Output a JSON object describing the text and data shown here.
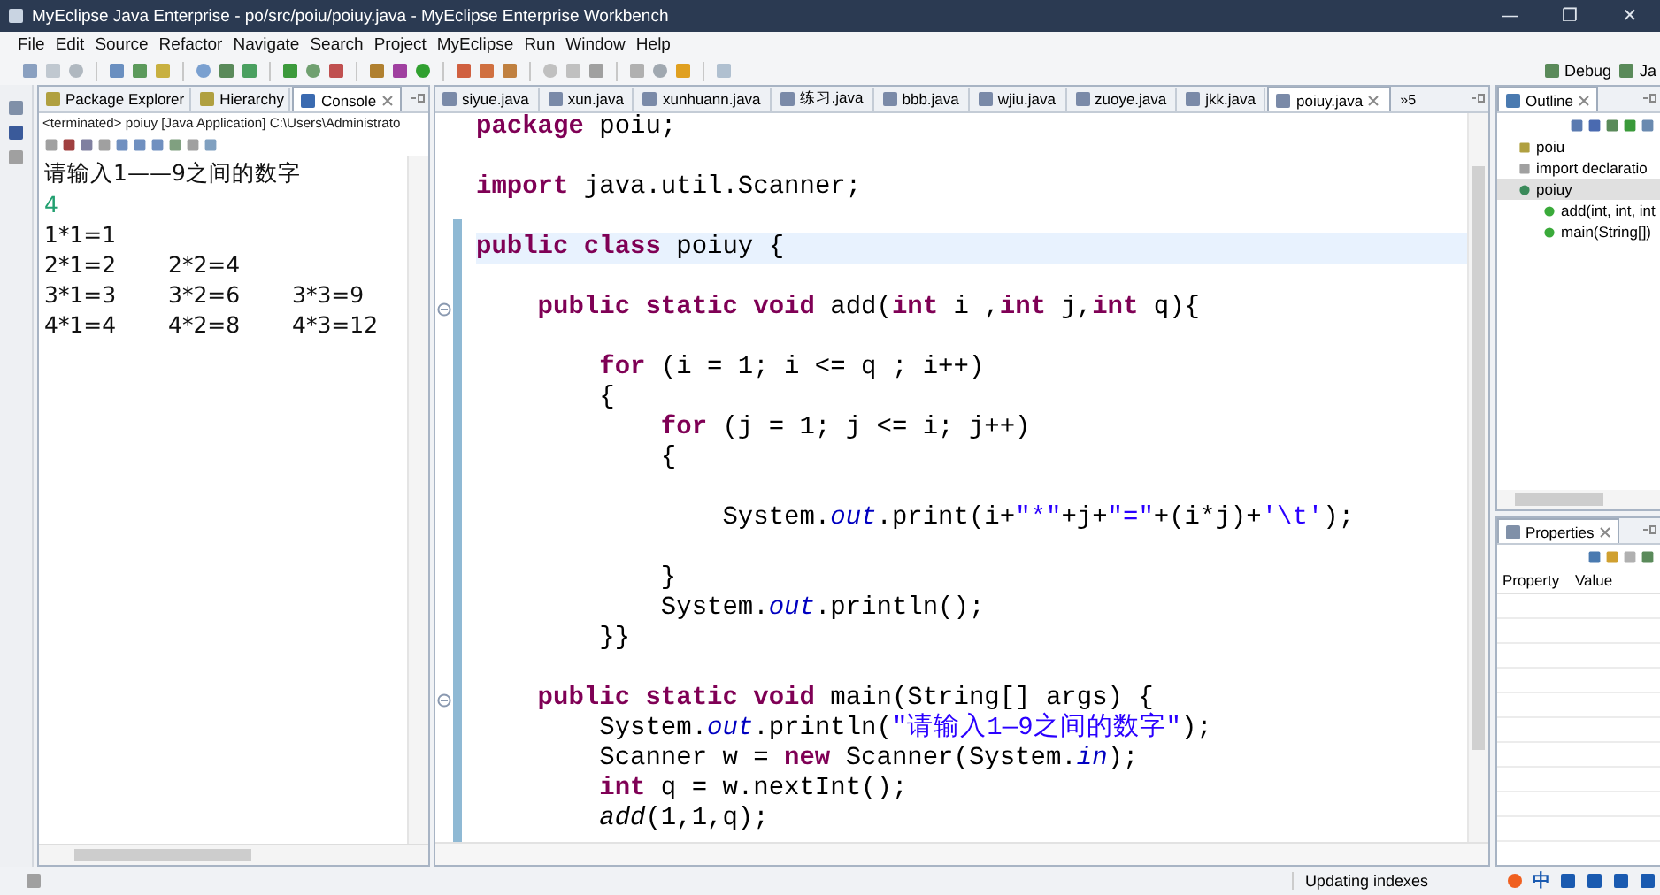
{
  "window": {
    "title": "MyEclipse Java Enterprise - po/src/poiu/poiuy.java - MyEclipse Enterprise Workbench",
    "controls": [
      "—",
      "❐",
      "✕"
    ]
  },
  "menu": [
    "File",
    "Edit",
    "Source",
    "Refactor",
    "Navigate",
    "Search",
    "Project",
    "MyEclipse",
    "Run",
    "Window",
    "Help"
  ],
  "perspectives": [
    {
      "label": "Debug"
    },
    {
      "label": "Ja"
    }
  ],
  "left_panel": {
    "tabs": [
      {
        "label": "Package Explorer",
        "selected": false
      },
      {
        "label": "Hierarchy",
        "selected": false
      },
      {
        "label": "Console",
        "selected": true
      }
    ],
    "console_header": "<terminated> poiuy [Java Application] C:\\Users\\Administrato",
    "lines": [
      {
        "kind": "output",
        "cells": [
          "请输入1——9之间的数字"
        ]
      },
      {
        "kind": "input",
        "cells": [
          "4"
        ]
      },
      {
        "kind": "output",
        "cells": [
          "1*1=1"
        ]
      },
      {
        "kind": "output",
        "cells": [
          "2*1=2",
          "2*2=4"
        ]
      },
      {
        "kind": "output",
        "cells": [
          "3*1=3",
          "3*2=6",
          "3*3=9"
        ]
      },
      {
        "kind": "output",
        "cells": [
          "4*1=4",
          "4*2=8",
          "4*3=12"
        ]
      }
    ]
  },
  "editor": {
    "tabs": [
      {
        "label": "siyue.java",
        "selected": false
      },
      {
        "label": "xun.java",
        "selected": false
      },
      {
        "label": "xunhuann.java",
        "selected": false
      },
      {
        "label": "练习.java",
        "selected": false
      },
      {
        "label": "bbb.java",
        "selected": false
      },
      {
        "label": "wjiu.java",
        "selected": false
      },
      {
        "label": "zuoye.java",
        "selected": false
      },
      {
        "label": "jkk.java",
        "selected": false
      },
      {
        "label": "poiuy.java",
        "selected": true
      }
    ],
    "overflow": "»5",
    "lines": [
      {
        "kind": "code",
        "current": false,
        "fold": false,
        "segments": [
          {
            "kind": "keyword",
            "text": "package"
          },
          {
            "kind": "plain",
            "text": " poiu;"
          }
        ]
      },
      {
        "kind": "blank"
      },
      {
        "kind": "code",
        "current": false,
        "fold": false,
        "segments": [
          {
            "kind": "keyword",
            "text": "import"
          },
          {
            "kind": "plain",
            "text": " java.util.Scanner;"
          }
        ]
      },
      {
        "kind": "blank"
      },
      {
        "kind": "code",
        "current": true,
        "fold": false,
        "segments": [
          {
            "kind": "keyword",
            "text": "public class"
          },
          {
            "kind": "plain",
            "text": " poiuy {"
          }
        ]
      },
      {
        "kind": "blank"
      },
      {
        "kind": "code",
        "current": false,
        "fold": true,
        "segments": [
          {
            "kind": "keyword",
            "text": "    public static void"
          },
          {
            "kind": "plain",
            "text": " add("
          },
          {
            "kind": "keyword",
            "text": "int"
          },
          {
            "kind": "plain",
            "text": " i ,"
          },
          {
            "kind": "keyword",
            "text": "int"
          },
          {
            "kind": "plain",
            "text": " j,"
          },
          {
            "kind": "keyword",
            "text": "int"
          },
          {
            "kind": "plain",
            "text": " q){"
          }
        ]
      },
      {
        "kind": "blank"
      },
      {
        "kind": "code",
        "current": false,
        "fold": false,
        "segments": [
          {
            "kind": "keyword",
            "text": "        for"
          },
          {
            "kind": "plain",
            "text": " (i = 1; i <= q ; i++)"
          }
        ]
      },
      {
        "kind": "code",
        "current": false,
        "fold": false,
        "segments": [
          {
            "kind": "plain",
            "text": "        {"
          }
        ]
      },
      {
        "kind": "code",
        "current": false,
        "fold": false,
        "segments": [
          {
            "kind": "keyword",
            "text": "            for"
          },
          {
            "kind": "plain",
            "text": " (j = 1; j <= i; j++)"
          }
        ]
      },
      {
        "kind": "code",
        "current": false,
        "fold": false,
        "segments": [
          {
            "kind": "plain",
            "text": "            {"
          }
        ]
      },
      {
        "kind": "blank"
      },
      {
        "kind": "code",
        "current": false,
        "fold": false,
        "segments": [
          {
            "kind": "plain",
            "text": "                System."
          },
          {
            "kind": "field",
            "text": "out"
          },
          {
            "kind": "plain",
            "text": ".print(i+"
          },
          {
            "kind": "string",
            "text": "\"*\""
          },
          {
            "kind": "plain",
            "text": "+j+"
          },
          {
            "kind": "string",
            "text": "\"=\""
          },
          {
            "kind": "plain",
            "text": "+(i*j)+"
          },
          {
            "kind": "string",
            "text": "'\\t'"
          },
          {
            "kind": "plain",
            "text": ");"
          }
        ]
      },
      {
        "kind": "blank"
      },
      {
        "kind": "code",
        "current": false,
        "fold": false,
        "segments": [
          {
            "kind": "plain",
            "text": "            }"
          }
        ]
      },
      {
        "kind": "code",
        "current": false,
        "fold": false,
        "segments": [
          {
            "kind": "plain",
            "text": "            System."
          },
          {
            "kind": "field",
            "text": "out"
          },
          {
            "kind": "plain",
            "text": ".println();"
          }
        ]
      },
      {
        "kind": "code",
        "current": false,
        "fold": false,
        "segments": [
          {
            "kind": "plain",
            "text": "        }}"
          }
        ]
      },
      {
        "kind": "blank"
      },
      {
        "kind": "code",
        "current": false,
        "fold": true,
        "segments": [
          {
            "kind": "keyword",
            "text": "    public static void"
          },
          {
            "kind": "plain",
            "text": " main(String[] args) {"
          }
        ]
      },
      {
        "kind": "code",
        "current": false,
        "fold": false,
        "segments": [
          {
            "kind": "plain",
            "text": "        System."
          },
          {
            "kind": "field",
            "text": "out"
          },
          {
            "kind": "plain",
            "text": ".println("
          },
          {
            "kind": "string",
            "text": "\"请输入1—9之间的数字\""
          },
          {
            "kind": "plain",
            "text": ");"
          }
        ]
      },
      {
        "kind": "code",
        "current": false,
        "fold": false,
        "segments": [
          {
            "kind": "plain",
            "text": "        Scanner w = "
          },
          {
            "kind": "keyword",
            "text": "new"
          },
          {
            "kind": "plain",
            "text": " Scanner(System."
          },
          {
            "kind": "field",
            "text": "in"
          },
          {
            "kind": "plain",
            "text": ");"
          }
        ]
      },
      {
        "kind": "code",
        "current": false,
        "fold": false,
        "segments": [
          {
            "kind": "keyword",
            "text": "        int"
          },
          {
            "kind": "plain",
            "text": " q = w.nextInt();"
          }
        ]
      },
      {
        "kind": "code",
        "current": false,
        "fold": false,
        "segments": [
          {
            "kind": "static_call",
            "text": "        add"
          },
          {
            "kind": "plain",
            "text": "(1,1,q);"
          }
        ]
      }
    ]
  },
  "outline": {
    "title": "Outline",
    "items": [
      {
        "label": "poiu",
        "kind": "package",
        "selected": false
      },
      {
        "label": "import declaratio",
        "kind": "imports",
        "selected": false
      },
      {
        "label": "poiuy",
        "kind": "class",
        "selected": true,
        "children": [
          {
            "label": "add(int, int, int",
            "kind": "method",
            "selected": false
          },
          {
            "label": "main(String[])",
            "kind": "method",
            "selected": false
          }
        ]
      }
    ]
  },
  "properties": {
    "title": "Properties",
    "columns": [
      "Property",
      "Value"
    ]
  },
  "status_bar": {
    "message": "Updating indexes",
    "ime": "中"
  }
}
